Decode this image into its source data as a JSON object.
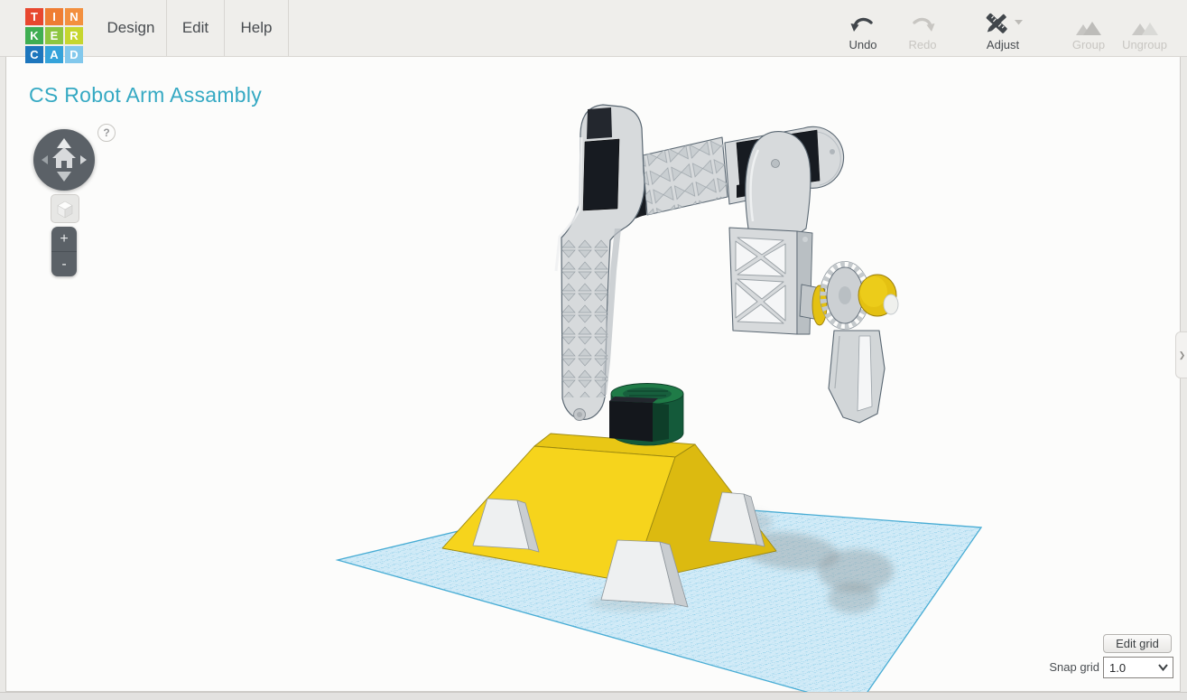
{
  "header": {
    "logo_tiles": [
      {
        "ch": "T",
        "bg": "#e8472f"
      },
      {
        "ch": "I",
        "bg": "#ef7d33"
      },
      {
        "ch": "N",
        "bg": "#f3903f"
      },
      {
        "ch": "K",
        "bg": "#3fae52"
      },
      {
        "ch": "E",
        "bg": "#8dc640"
      },
      {
        "ch": "R",
        "bg": "#c6d62f"
      },
      {
        "ch": "C",
        "bg": "#1d76bd"
      },
      {
        "ch": "A",
        "bg": "#35a3da"
      },
      {
        "ch": "D",
        "bg": "#82c8ec"
      }
    ],
    "menus": [
      {
        "label": "Design"
      },
      {
        "label": "Edit"
      },
      {
        "label": "Help"
      }
    ],
    "tools": [
      {
        "label": "Undo",
        "enabled": true
      },
      {
        "label": "Redo",
        "enabled": false
      },
      {
        "label": "Adjust",
        "enabled": true,
        "has_dropdown": true
      },
      {
        "label": "Group",
        "enabled": false
      },
      {
        "label": "Ungroup",
        "enabled": false
      }
    ]
  },
  "canvas": {
    "design_title": "CS Robot Arm Assambly",
    "help_glyph": "?",
    "zoom_in_glyph": "+",
    "zoom_out_glyph": "-",
    "panel_toggle_glyph": "❯",
    "grid_controls": {
      "edit_grid_label": "Edit grid",
      "snap_grid_label": "Snap grid",
      "snap_grid_value": "1.0"
    },
    "scene": {
      "workplane": "blue snap grid workplane",
      "model_parts": [
        {
          "name": "base pyramid",
          "color": "#f6d41c"
        },
        {
          "name": "corner feet",
          "color": "#eef0f1"
        },
        {
          "name": "rotator drum with servo",
          "color": "#1f7b47"
        },
        {
          "name": "vertical lattice arm",
          "color": "#d7dadc"
        },
        {
          "name": "servo motors",
          "color": "#171b21"
        },
        {
          "name": "horizontal lattice arm",
          "color": "#d7dadc"
        },
        {
          "name": "swing link",
          "color": "#d7dadc"
        },
        {
          "name": "x-lattice forearm panel",
          "color": "#d7dadc"
        },
        {
          "name": "wrist gear",
          "color": "#ccd0d3"
        },
        {
          "name": "wrist hub",
          "color": "#e4c112"
        },
        {
          "name": "gripper claw",
          "color": "#d2d6d8"
        }
      ]
    }
  },
  "colors": {
    "page-bg": "#eae9e6",
    "header-bg": "#efeeeb",
    "header-line": "#d8d6d2",
    "menu-text": "#474b4f",
    "disabled": "#c8c6c2",
    "icon-dark": "#41464b",
    "title": "#35a9c3",
    "canvas-bg": "#fcfcfb",
    "edge": "#cfcdc9",
    "nav": "#5b6167",
    "nav-line": "#4a5056",
    "grid-base": "#d4ecf8",
    "grid-fine": "#bfe2f2",
    "grid-major": "#66bcdf",
    "grid-border": "#47acd4",
    "g-light": "#d7dadc",
    "g-mid": "#b9bfc3",
    "g-dark2": "#9aa1a6",
    "ol": "#5a6772",
    "hole": "#f5f6f7",
    "servo": "#171b21",
    "servo2": "#23272e",
    "y-bright": "#f6d41c",
    "y-dark": "#dcba10",
    "y-top": "#e9c715",
    "y-ol": "#9b8810",
    "grn-top": "#1f7b47",
    "grn-body": "#145a3a",
    "grn-dark": "#0e3e29",
    "hub": "#e4c112",
    "hub-ol": "#9c800d",
    "shadow": "#8e9598"
  }
}
